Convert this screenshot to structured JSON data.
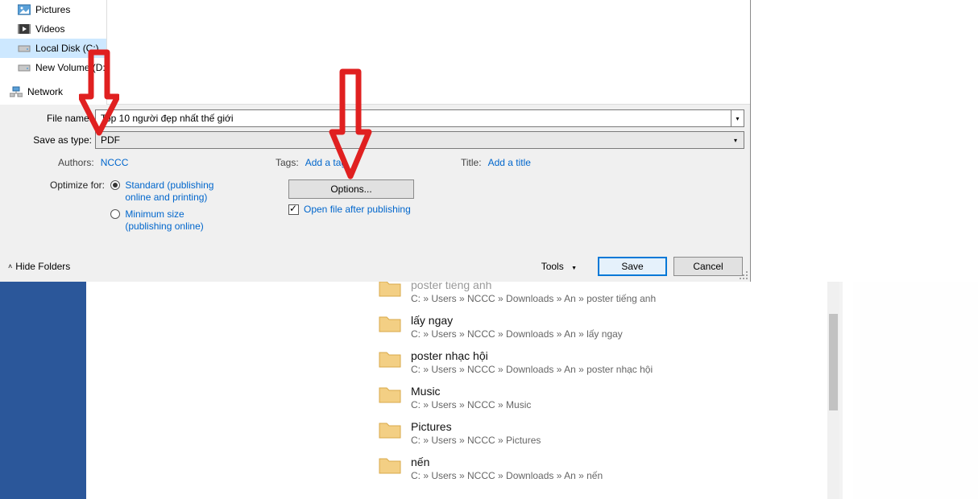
{
  "tree": {
    "items": [
      {
        "label": "Pictures"
      },
      {
        "label": "Videos"
      },
      {
        "label": "Local Disk (C:)"
      },
      {
        "label": "New Volume (D:)"
      }
    ],
    "network": "Network"
  },
  "form": {
    "filename_label": "File name:",
    "filename_value": "Top 10 người đẹp nhất thế giới",
    "savetype_label": "Save as type:",
    "savetype_value": "PDF"
  },
  "meta": {
    "authors_label": "Authors:",
    "authors_value": "NCCC",
    "tags_label": "Tags:",
    "tags_value": "Add a tag",
    "title_label": "Title:",
    "title_value": "Add a title"
  },
  "optimize": {
    "label": "Optimize for:",
    "option1": "Standard (publishing online and printing)",
    "option2": "Minimum size (publishing online)"
  },
  "options_btn": "Options...",
  "open_after": "Open file after publishing",
  "footer": {
    "hide": "Hide Folders",
    "tools": "Tools",
    "save": "Save",
    "cancel": "Cancel"
  },
  "bg_list": [
    {
      "title": "poster tiếng anh",
      "path": "C: » Users » NCCC » Downloads » An » poster tiếng anh",
      "cut": true
    },
    {
      "title": "lấy ngay",
      "path": "C: » Users » NCCC » Downloads » An » lấy ngay"
    },
    {
      "title": "poster nhạc hội",
      "path": "C: » Users » NCCC » Downloads » An » poster nhạc hội"
    },
    {
      "title": "Music",
      "path": "C: » Users » NCCC » Music"
    },
    {
      "title": "Pictures",
      "path": "C: » Users » NCCC » Pictures"
    },
    {
      "title": "nến",
      "path": "C: » Users » NCCC » Downloads » An » nến"
    }
  ]
}
